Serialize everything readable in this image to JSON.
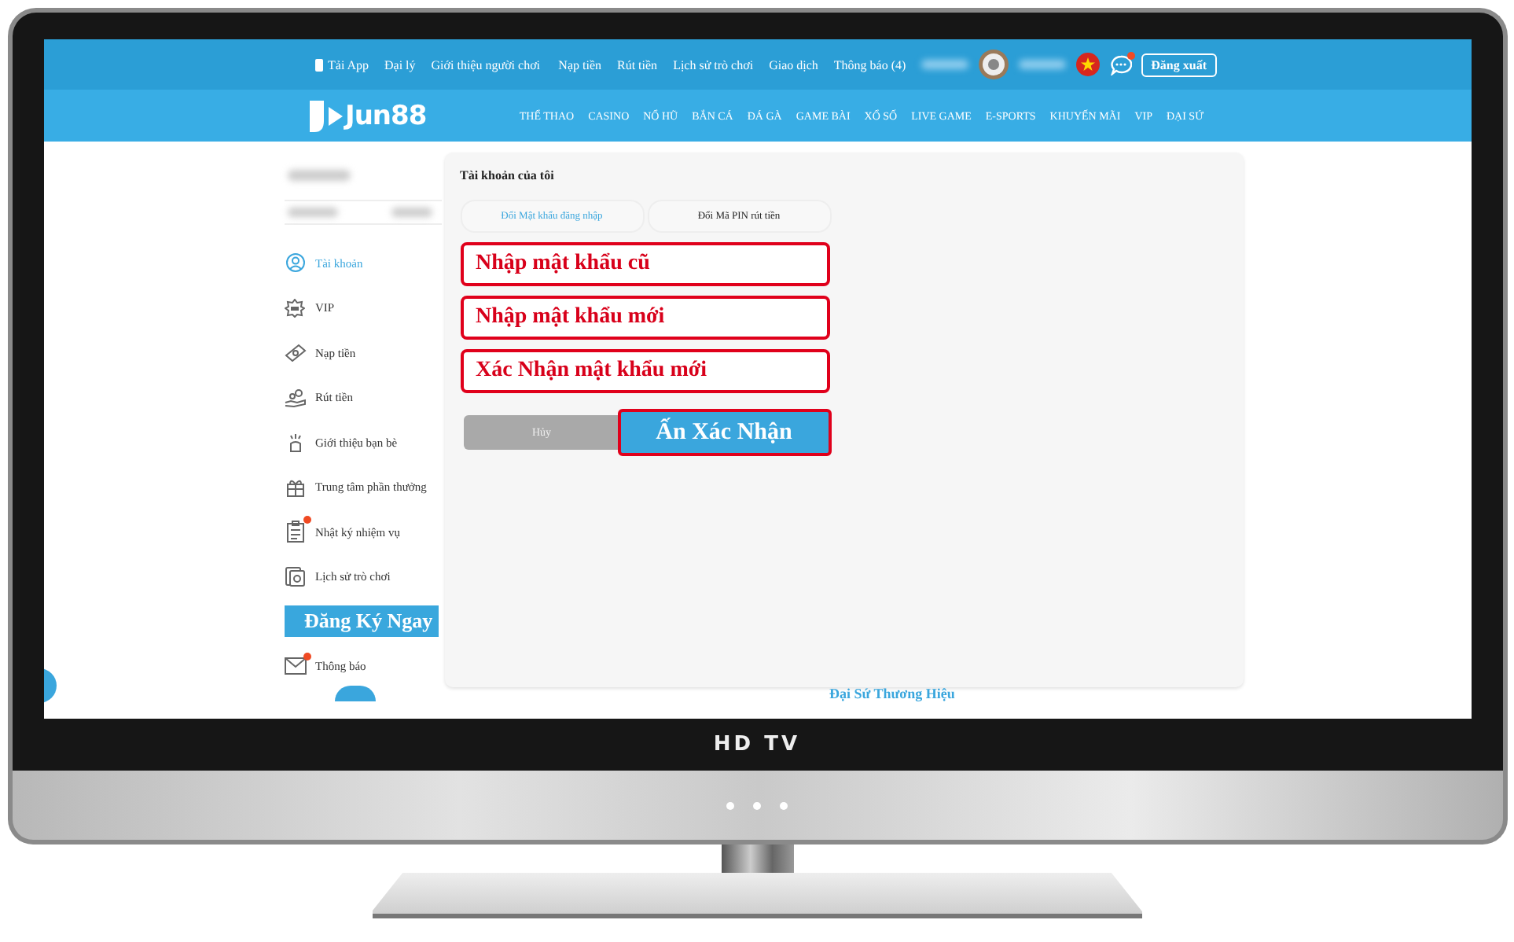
{
  "top_bar": {
    "left_links": [
      "Tải App",
      "Đại lý",
      "Giới thiệu người chơi"
    ],
    "center_links": [
      "Nạp tiền",
      "Rút tiền",
      "Lịch sử trò chơi",
      "Giao dịch",
      "Thông báo (4)"
    ],
    "chat_unread": true,
    "logout_button": "Đăng xuất"
  },
  "nav": {
    "logo": "Jun88",
    "items": [
      "THỂ THAO",
      "CASINO",
      "NỔ HŨ",
      "BẮN CÁ",
      "ĐÁ GÀ",
      "GAME BÀI",
      "XỔ SỐ",
      "LIVE GAME",
      "E-SPORTS",
      "KHUYẾN MÃI",
      "VIP",
      "ĐẠI SỨ"
    ]
  },
  "sidebar": {
    "items": [
      {
        "label": "Tài khoản",
        "selected": true,
        "badge": false
      },
      {
        "label": "VIP",
        "selected": false,
        "badge": false
      },
      {
        "label": "Nạp tiền",
        "selected": false,
        "badge": false
      },
      {
        "label": "Rút tiền",
        "selected": false,
        "badge": false
      },
      {
        "label": "Giới thiệu bạn bè",
        "selected": false,
        "badge": false
      },
      {
        "label": "Trung tâm phần thưởng",
        "selected": false,
        "badge": false
      },
      {
        "label": "Nhật ký nhiệm vụ",
        "selected": false,
        "badge": true
      },
      {
        "label": "Lịch sử trò chơi",
        "selected": false,
        "badge": false
      },
      {
        "label": "Thông báo",
        "selected": false,
        "badge": true
      }
    ],
    "register_banner": "Đăng Ký Ngay"
  },
  "panel": {
    "title": "Tài khoản của tôi",
    "tabs": [
      {
        "label": "Đổi Mật khẩu đăng nhập",
        "selected": true
      },
      {
        "label": "Đổi Mã PIN rút tiền",
        "selected": false
      }
    ],
    "fields": [
      {
        "label": "Nhập mật khẩu cũ"
      },
      {
        "label": "Nhập mật khẩu mới"
      },
      {
        "label": "Xác Nhận mật khẩu mới"
      }
    ],
    "cancel_button": "Hủy",
    "confirm_button": "Ấn Xác Nhận"
  },
  "footer": {
    "heading": "Đại Sứ Thương Hiệu"
  },
  "tv": {
    "brand": "HD TV"
  }
}
